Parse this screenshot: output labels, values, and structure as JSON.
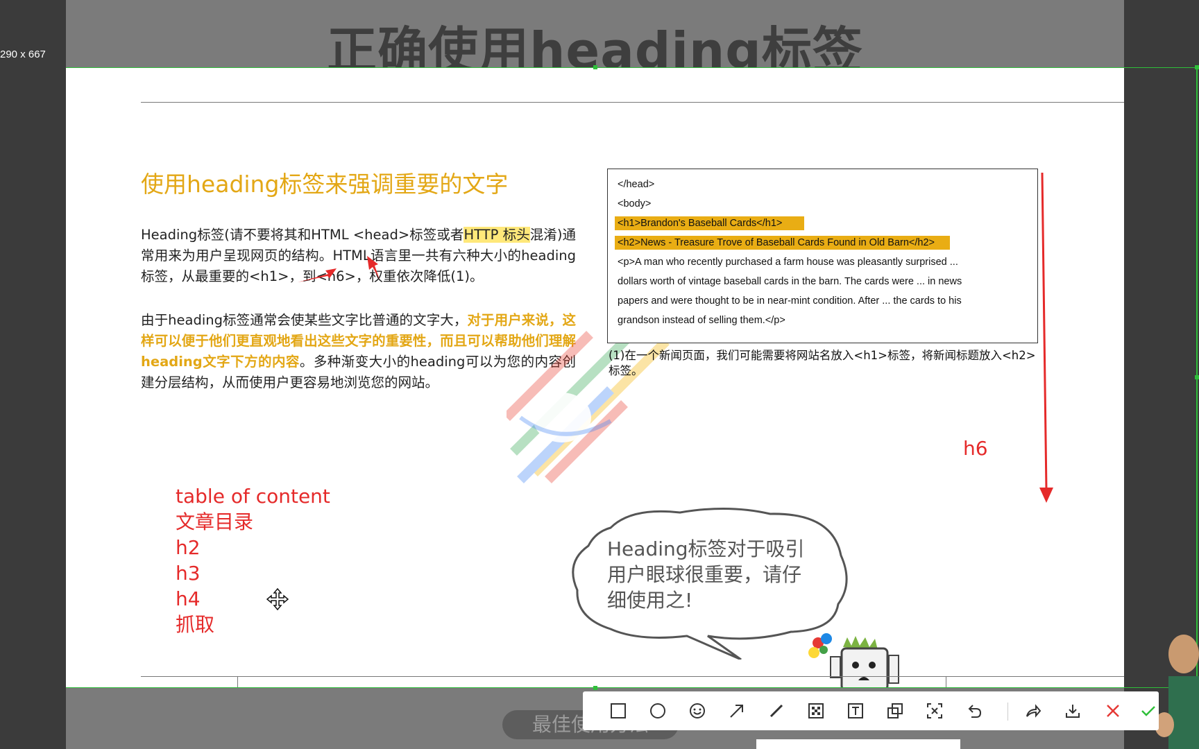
{
  "size_label": "290 x 667",
  "page_title": "正确使用heading标签",
  "section_heading": "使用heading标签来强调重要的文字",
  "para1": {
    "t1": "Heading标签(请不要将其和HTML <head>标签或者",
    "hl": "HTTP 标头",
    "t2": "混淆)通常用来为用户呈现网页的结构。HTML语言里一共有六种大小的heading标签，从最重要的<h1>，到<h6>，权重依次降低(1)。"
  },
  "para2": {
    "t1": "由于heading标签通常会使某些文字比普通的文字大，",
    "bold": "对于用户来说，这样可以便于他们更直观地看出这些文字的重要性，而且可以帮助他们理解heading文字下方的内容",
    "t2": "。多种渐变大小的heading可以为您的内容创建分层结构，从而使用户更容易地浏览您的网站。"
  },
  "code_lines": [
    "</head>",
    "<body>",
    "<h1>Brandon's Baseball Cards</h1>",
    "<h2>News - Treasure Trove of Baseball Cards Found in Old Barn</h2>",
    "<p>A man who recently purchased a farm house was pleasantly surprised ...",
    "dollars worth of vintage baseball cards in the barn. The cards were ... in news",
    "papers and were thought to be in near-mint condition. After ... the cards to his",
    "grandson instead of selling them.</p>"
  ],
  "caption": "(1)在一个新闻页面，我们可能需要将网站名放入<h1>标签，将新闻标题放入<h2>标签。",
  "annotations": {
    "toc": [
      "table of content",
      "文章目录",
      "h2",
      "h3",
      "h4",
      "抓取"
    ],
    "h6": "h6"
  },
  "bubble": [
    "Heading标签对于吸引",
    "用户眼球很重要，请仔",
    "细使用之!"
  ],
  "bottom_label": "最佳使用方法",
  "toolbar": {
    "tools": [
      "rectangle",
      "ellipse",
      "emoji",
      "arrow",
      "pen",
      "mosaic",
      "text",
      "pin",
      "ocr",
      "undo",
      "redo",
      "save",
      "cancel",
      "confirm"
    ]
  },
  "colors": {
    "accent_gold": "#e3a715",
    "annotation_red": "#e52a2a",
    "selection_green": "#2fbf3a"
  }
}
